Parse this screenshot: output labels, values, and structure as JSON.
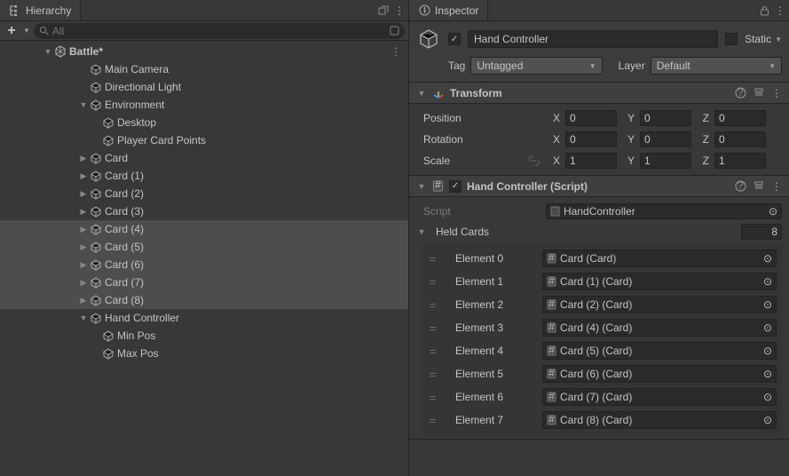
{
  "hierarchy": {
    "tab_label": "Hierarchy",
    "search_placeholder": "All",
    "scene": "Battle*",
    "items": [
      {
        "label": "Main Camera",
        "depth": 2,
        "fold": ""
      },
      {
        "label": "Directional Light",
        "depth": 2,
        "fold": ""
      },
      {
        "label": "Environment",
        "depth": 2,
        "fold": "▼"
      },
      {
        "label": "Desktop",
        "depth": 3,
        "fold": ""
      },
      {
        "label": "Player Card Points",
        "depth": 3,
        "fold": ""
      },
      {
        "label": "Card",
        "depth": 2,
        "fold": "▶"
      },
      {
        "label": "Card (1)",
        "depth": 2,
        "fold": "▶"
      },
      {
        "label": "Card (2)",
        "depth": 2,
        "fold": "▶"
      },
      {
        "label": "Card (3)",
        "depth": 2,
        "fold": "▶"
      },
      {
        "label": "Card (4)",
        "depth": 2,
        "fold": "▶",
        "sel": true
      },
      {
        "label": "Card (5)",
        "depth": 2,
        "fold": "▶",
        "sel": true
      },
      {
        "label": "Card (6)",
        "depth": 2,
        "fold": "▶",
        "sel": true
      },
      {
        "label": "Card (7)",
        "depth": 2,
        "fold": "▶",
        "sel": true
      },
      {
        "label": "Card (8)",
        "depth": 2,
        "fold": "▶",
        "sel": true
      },
      {
        "label": "Hand Controller",
        "depth": 2,
        "fold": "▼"
      },
      {
        "label": "Min Pos",
        "depth": 3,
        "fold": ""
      },
      {
        "label": "Max Pos",
        "depth": 3,
        "fold": ""
      }
    ]
  },
  "inspector": {
    "tab_label": "Inspector",
    "name": "Hand Controller",
    "enabled_check": "✓",
    "static_label": "Static",
    "tag_label": "Tag",
    "tag_value": "Untagged",
    "layer_label": "Layer",
    "layer_value": "Default",
    "transform": {
      "title": "Transform",
      "rows": [
        {
          "label": "Position",
          "x": "0",
          "y": "0",
          "z": "0"
        },
        {
          "label": "Rotation",
          "x": "0",
          "y": "0",
          "z": "0"
        },
        {
          "label": "Scale",
          "x": "1",
          "y": "1",
          "z": "1"
        }
      ]
    },
    "script": {
      "title": "Hand Controller (Script)",
      "enabled_check": "✓",
      "script_label": "Script",
      "script_value": "HandController",
      "held_label": "Held Cards",
      "held_count": "8",
      "elements": [
        {
          "label": "Element 0",
          "value": "Card (Card)"
        },
        {
          "label": "Element 1",
          "value": "Card (1) (Card)"
        },
        {
          "label": "Element 2",
          "value": "Card (2) (Card)"
        },
        {
          "label": "Element 3",
          "value": "Card (4) (Card)"
        },
        {
          "label": "Element 4",
          "value": "Card (5) (Card)"
        },
        {
          "label": "Element 5",
          "value": "Card (6) (Card)"
        },
        {
          "label": "Element 6",
          "value": "Card (7) (Card)"
        },
        {
          "label": "Element 7",
          "value": "Card (8) (Card)"
        }
      ]
    }
  }
}
